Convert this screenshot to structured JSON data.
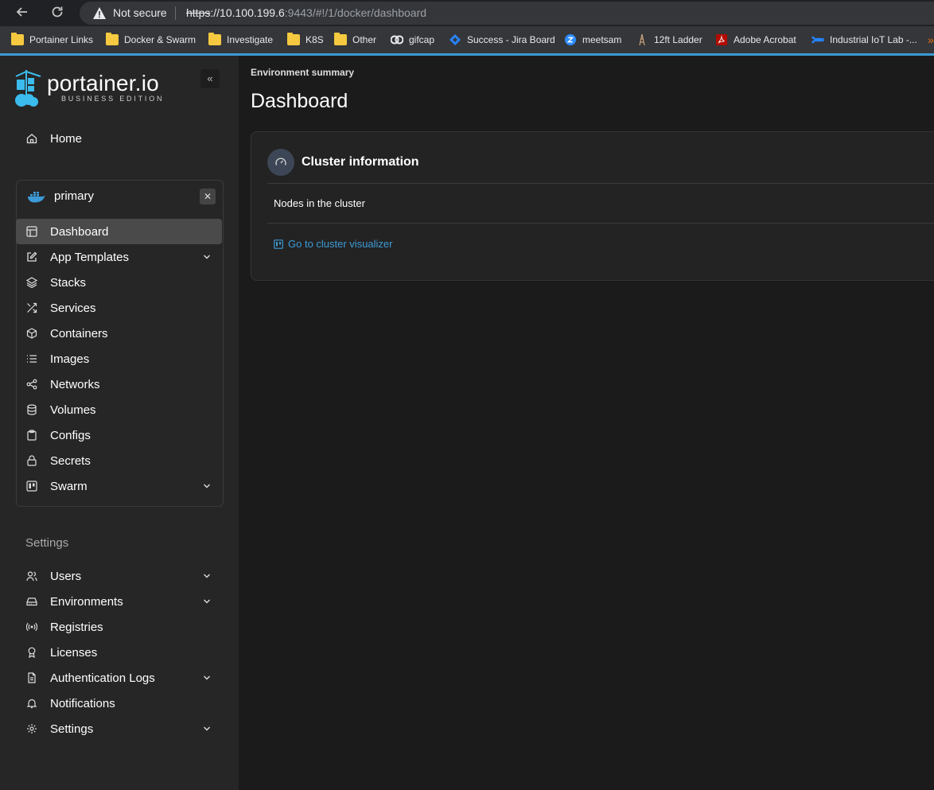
{
  "browser": {
    "security_label": "Not secure",
    "url_scheme": "https",
    "url_host": "://10.100.199.6",
    "url_rest": ":9443/#!/1/docker/dashboard"
  },
  "bookmarks": [
    {
      "label": "Portainer Links",
      "icon": "folder-icon"
    },
    {
      "label": "Docker & Swarm",
      "icon": "folder-icon"
    },
    {
      "label": "Investigate",
      "icon": "folder-icon"
    },
    {
      "label": "K8S",
      "icon": "folder-icon"
    },
    {
      "label": "Other",
      "icon": "folder-icon"
    },
    {
      "label": "gifcap",
      "icon": "gifcap-icon"
    },
    {
      "label": "Success - Jira Board",
      "icon": "jira-icon"
    },
    {
      "label": "meetsam",
      "icon": "zoom-icon"
    },
    {
      "label": "12ft Ladder",
      "icon": "ladder-icon"
    },
    {
      "label": "Adobe Acrobat",
      "icon": "acrobat-icon"
    },
    {
      "label": "Industrial IoT Lab -...",
      "icon": "confluence-icon"
    }
  ],
  "brand": {
    "name": "portainer.io",
    "edition": "BUSINESS EDITION",
    "accent": "#3c9ad6"
  },
  "sidebar": {
    "home": "Home",
    "environment": {
      "name": "primary",
      "items": [
        {
          "label": "Dashboard",
          "icon": "dashboard-icon"
        },
        {
          "label": "App Templates",
          "icon": "edit-icon"
        },
        {
          "label": "Stacks",
          "icon": "layers-icon"
        },
        {
          "label": "Services",
          "icon": "shuffle-icon"
        },
        {
          "label": "Containers",
          "icon": "box-icon"
        },
        {
          "label": "Images",
          "icon": "list-icon"
        },
        {
          "label": "Networks",
          "icon": "share-icon"
        },
        {
          "label": "Volumes",
          "icon": "database-icon"
        },
        {
          "label": "Configs",
          "icon": "clipboard-icon"
        },
        {
          "label": "Secrets",
          "icon": "lock-icon"
        },
        {
          "label": "Swarm",
          "icon": "trello-icon"
        }
      ]
    },
    "settings_heading": "Settings",
    "settings_items": [
      {
        "label": "Users",
        "icon": "users-icon"
      },
      {
        "label": "Environments",
        "icon": "hard-drive-icon"
      },
      {
        "label": "Registries",
        "icon": "radio-icon"
      },
      {
        "label": "Licenses",
        "icon": "award-icon"
      },
      {
        "label": "Authentication Logs",
        "icon": "file-text-icon"
      },
      {
        "label": "Notifications",
        "icon": "bell-icon"
      },
      {
        "label": "Settings",
        "icon": "settings-icon"
      }
    ]
  },
  "main": {
    "breadcrumb": "Environment summary",
    "title": "Dashboard",
    "card": {
      "title": "Cluster information",
      "nodes_label": "Nodes in the cluster",
      "link": "Go to cluster visualizer"
    }
  }
}
